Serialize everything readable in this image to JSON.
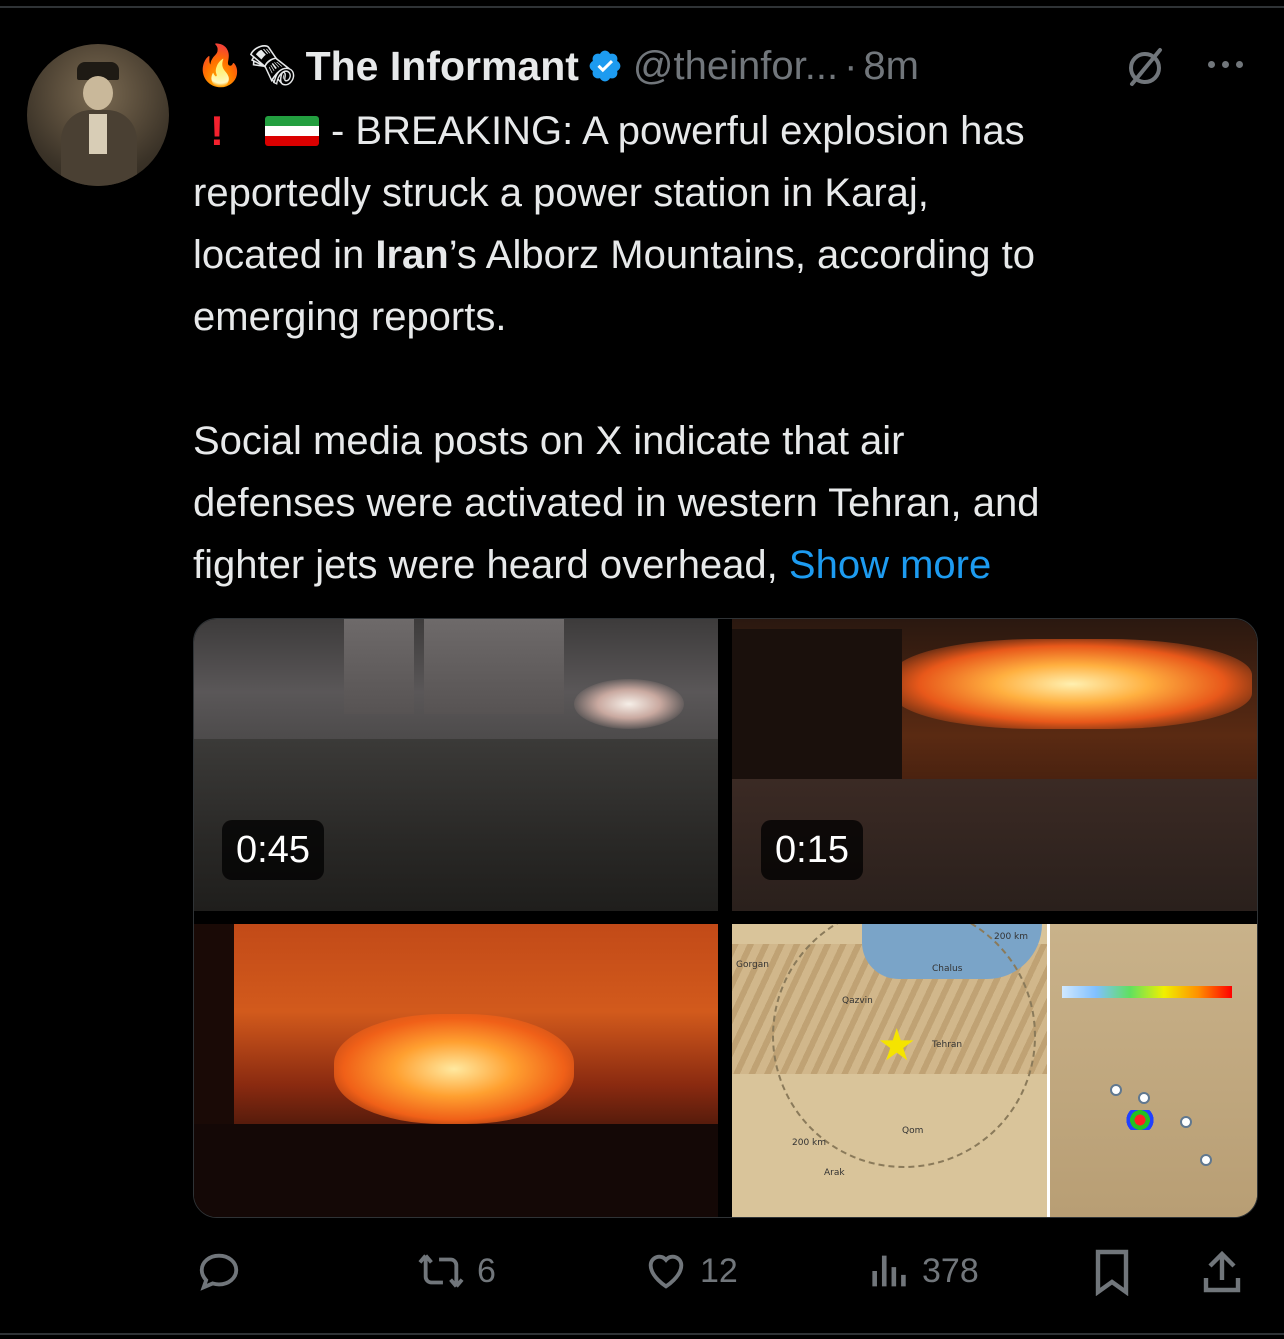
{
  "author": {
    "emoji_prefix": "🔥🗞",
    "display_name": "The Informant",
    "handle": "@theinfor...",
    "separator": "·",
    "time": "8m"
  },
  "tweet": {
    "line1_text": "- BREAKING: A powerful explosion has",
    "line2": "reportedly struck a power station in Karaj,",
    "line3_pre": "located in ",
    "line3_bold": "Iran",
    "line3_post": "’s Alborz Mountains, according to",
    "line4": "emerging reports.",
    "para2_line1": "Social media posts on X indicate that air",
    "para2_line2": "defenses were activated in western Tehran, and",
    "para2_line3": "fighter jets were heard overhead,",
    "show_more": "Show more",
    "exclaim": "!"
  },
  "media": {
    "video1_duration": "0:45",
    "video2_duration": "0:15",
    "map_labels": {
      "distance_top": "200 km",
      "distance_bottom": "200 km",
      "chalus": "Chalus",
      "qazvin": "Qazvin",
      "tehran": "Tehran",
      "qom": "Qom",
      "arak": "Arak",
      "gorgan": "Gorgan"
    }
  },
  "actions": {
    "replies": "",
    "reposts": "6",
    "likes": "12",
    "views": "378"
  },
  "colors": {
    "background": "#000000",
    "text": "#e7e9ea",
    "muted": "#71767b",
    "link": "#1d9bf0",
    "verified": "#1d9bf0"
  },
  "icons": [
    "fire-emoji",
    "newspaper-emoji",
    "verified-badge-icon",
    "grok-icon",
    "more-options-icon",
    "exclamation-emoji",
    "iran-flag-icon",
    "reply-icon",
    "repost-icon",
    "like-icon",
    "views-icon",
    "bookmark-icon",
    "share-icon"
  ]
}
